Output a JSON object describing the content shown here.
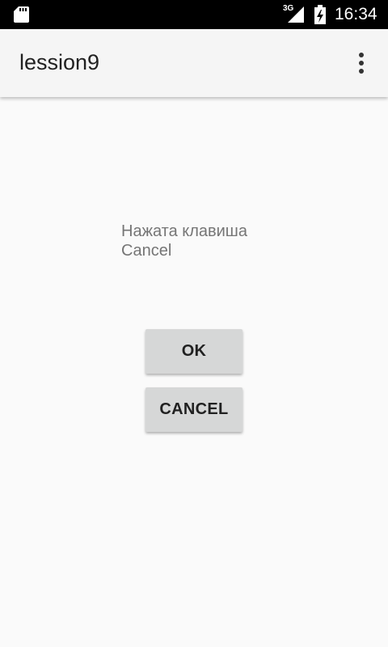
{
  "status_bar": {
    "time": "16:34",
    "network_type": "3G",
    "icons": [
      "sd-card-icon",
      "signal-icon",
      "battery-charging-icon"
    ]
  },
  "app_bar": {
    "title": "lession9",
    "overflow_icon": "more-vert-icon"
  },
  "content": {
    "message_line1": "Нажата клавиша",
    "message_line2": "Cancel"
  },
  "buttons": {
    "ok_label": "OK",
    "cancel_label": "CANCEL"
  },
  "colors": {
    "status_bar_bg": "#000000",
    "app_bar_bg": "#f5f5f5",
    "page_bg": "#fafafa",
    "button_bg": "#d6d7d7",
    "message_text": "#757575"
  }
}
